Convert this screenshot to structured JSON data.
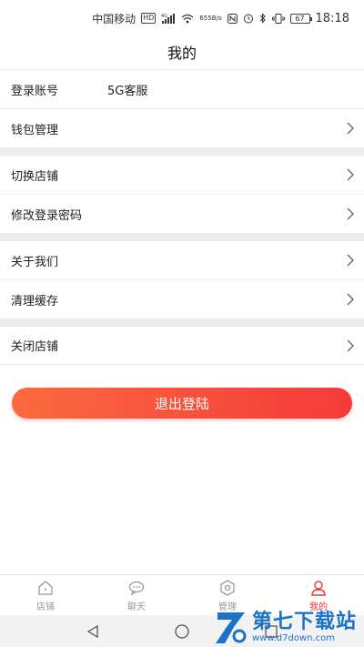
{
  "status_bar": {
    "carrier": "中国移动",
    "hd": "HD",
    "signal_type": "4G",
    "net_speed_value": "655",
    "net_speed_unit": "B/s",
    "battery": "67",
    "time": "18:18"
  },
  "header": {
    "title": "我的"
  },
  "account": {
    "label": "登录账号",
    "value": "5G客服"
  },
  "groups": [
    {
      "items": [
        {
          "label": "钱包管理"
        }
      ]
    },
    {
      "items": [
        {
          "label": "切换店铺"
        },
        {
          "label": "修改登录密码"
        }
      ]
    },
    {
      "items": [
        {
          "label": "关于我们"
        },
        {
          "label": "清理缓存"
        }
      ]
    },
    {
      "items": [
        {
          "label": "关闭店铺"
        }
      ]
    }
  ],
  "logout": {
    "label": "退出登陆"
  },
  "tabs": [
    {
      "label": "店铺",
      "icon": "home-icon",
      "active": false
    },
    {
      "label": "聊天",
      "icon": "chat-icon",
      "active": false
    },
    {
      "label": "管理",
      "icon": "eye-icon",
      "active": false
    },
    {
      "label": "我的",
      "icon": "user-icon",
      "active": true
    }
  ],
  "watermark": {
    "cn": "第七下载站",
    "en": "www.d7down.com"
  },
  "colors": {
    "accent": "#e8392f",
    "gradient_start": "#fb6a3f",
    "gradient_end": "#f53a3a"
  }
}
